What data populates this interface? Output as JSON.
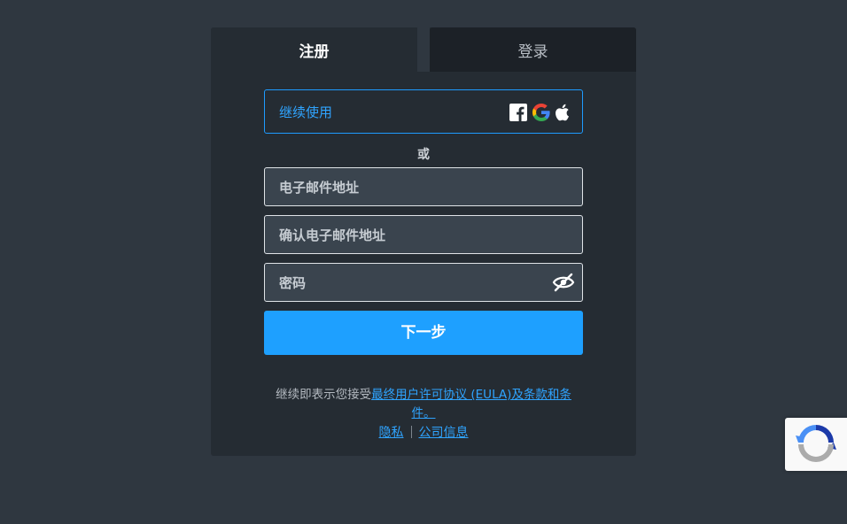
{
  "tabs": {
    "register": "注册",
    "login": "登录"
  },
  "continue": {
    "label": "继续使用",
    "providers": [
      "facebook-icon",
      "google-icon",
      "apple-icon"
    ]
  },
  "divider": "或",
  "fields": {
    "email_placeholder": "电子邮件地址",
    "confirm_email_placeholder": "确认电子邮件地址",
    "password_placeholder": "密码"
  },
  "next_label": "下一步",
  "terms": {
    "prefix": "继续即表示您接受",
    "link": "最终用户许可协议 (EULA)及条款和条件。"
  },
  "footer": {
    "privacy": "隐私",
    "company": "公司信息"
  },
  "colors": {
    "accent": "#1ea0ff",
    "page_bg": "#2f3740",
    "card_bg": "#252c33"
  }
}
